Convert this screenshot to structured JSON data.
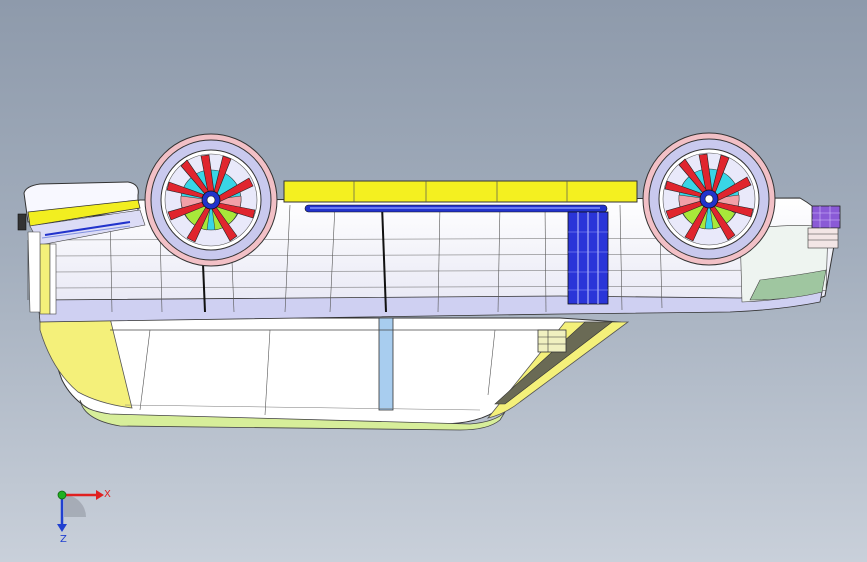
{
  "triad": {
    "x_label": "X",
    "z_label": "Z",
    "x_color": "#e02020",
    "z_color": "#2040d0",
    "y_color": "#20b020"
  },
  "colors": {
    "body_white": "#ffffff",
    "body_lavender": "#d8d8f2",
    "roof_white": "#fdfdfd",
    "trim_yellow": "#f6f05a",
    "bright_yellow": "#f2ee20",
    "sill_green": "#d9efa0",
    "rail_blue": "#2233cc",
    "pillar_blue": "#9ec6ee",
    "tail_purple": "#8a5ad6",
    "rim_lavender": "#c9c9ee",
    "spoke_red": "#e0252e",
    "hub_cyan": "#39d5e6",
    "hub_green": "#a8e83a",
    "hub_pink": "#f2a0a8"
  }
}
